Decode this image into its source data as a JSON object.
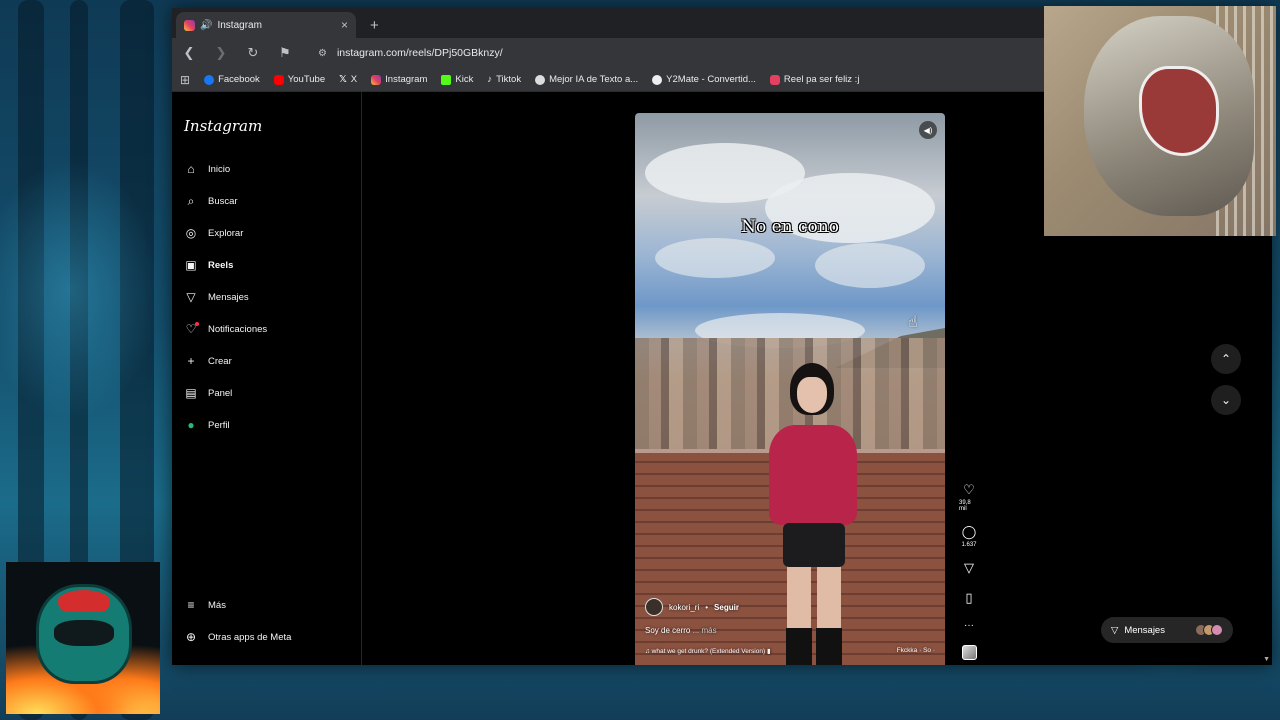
{
  "browser": {
    "tab": {
      "title": "Instagram",
      "close": "×"
    },
    "new_tab": "+",
    "url": "instagram.com/reels/DPj50GBknzy/",
    "bookmarks": [
      {
        "label": "Facebook",
        "color": "#1877f2"
      },
      {
        "label": "YouTube",
        "color": "#ff0000"
      },
      {
        "label": "X",
        "color": "#ffffff"
      },
      {
        "label": "Instagram",
        "color": "#e4405f"
      },
      {
        "label": "Kick",
        "color": "#53fc18"
      },
      {
        "label": "Tiktok",
        "color": "#ffffff"
      },
      {
        "label": "Mejor IA de Texto a...",
        "color": "#dddddd"
      },
      {
        "label": "Y2Mate - Convertid...",
        "color": "#eeeeee"
      },
      {
        "label": "Reel pa ser feliz :j",
        "color": "#e4405f"
      }
    ]
  },
  "instagram": {
    "logo": "Instagram",
    "nav": [
      {
        "label": "Inicio",
        "icon": "home-icon",
        "glyph": "⌂"
      },
      {
        "label": "Buscar",
        "icon": "search-icon",
        "glyph": "⌕"
      },
      {
        "label": "Explorar",
        "icon": "compass-icon",
        "glyph": "◎"
      },
      {
        "label": "Reels",
        "icon": "reels-icon",
        "glyph": "▣"
      },
      {
        "label": "Mensajes",
        "icon": "send-icon",
        "glyph": "▽"
      },
      {
        "label": "Notificaciones",
        "icon": "heart-icon",
        "glyph": "♡"
      },
      {
        "label": "Crear",
        "icon": "plus-icon",
        "glyph": "+"
      },
      {
        "label": "Panel",
        "icon": "dashboard-icon",
        "glyph": "▤"
      },
      {
        "label": "Perfil",
        "icon": "profile-icon",
        "glyph": "●"
      }
    ],
    "more": {
      "label": "Más",
      "glyph": "≡"
    },
    "meta": {
      "label": "Otras apps de Meta",
      "glyph": "⊕"
    },
    "reel": {
      "caption_overlay": "No en cono",
      "username": "kokori_ri",
      "separator": "•",
      "follow": "Seguir",
      "description": "Soy de cerro",
      "more": "... más",
      "audio": "♫ what we get drunk? (Extended Version) ▮",
      "audio_artist": "Fkckka · So ·"
    },
    "actions": {
      "likes": "39,8 mil",
      "comments": "1.637"
    },
    "messages_pill": "Mensajes"
  },
  "colors": {
    "accent": "#e4405f",
    "page_bg": "#000000",
    "pill_bg": "#262626"
  }
}
